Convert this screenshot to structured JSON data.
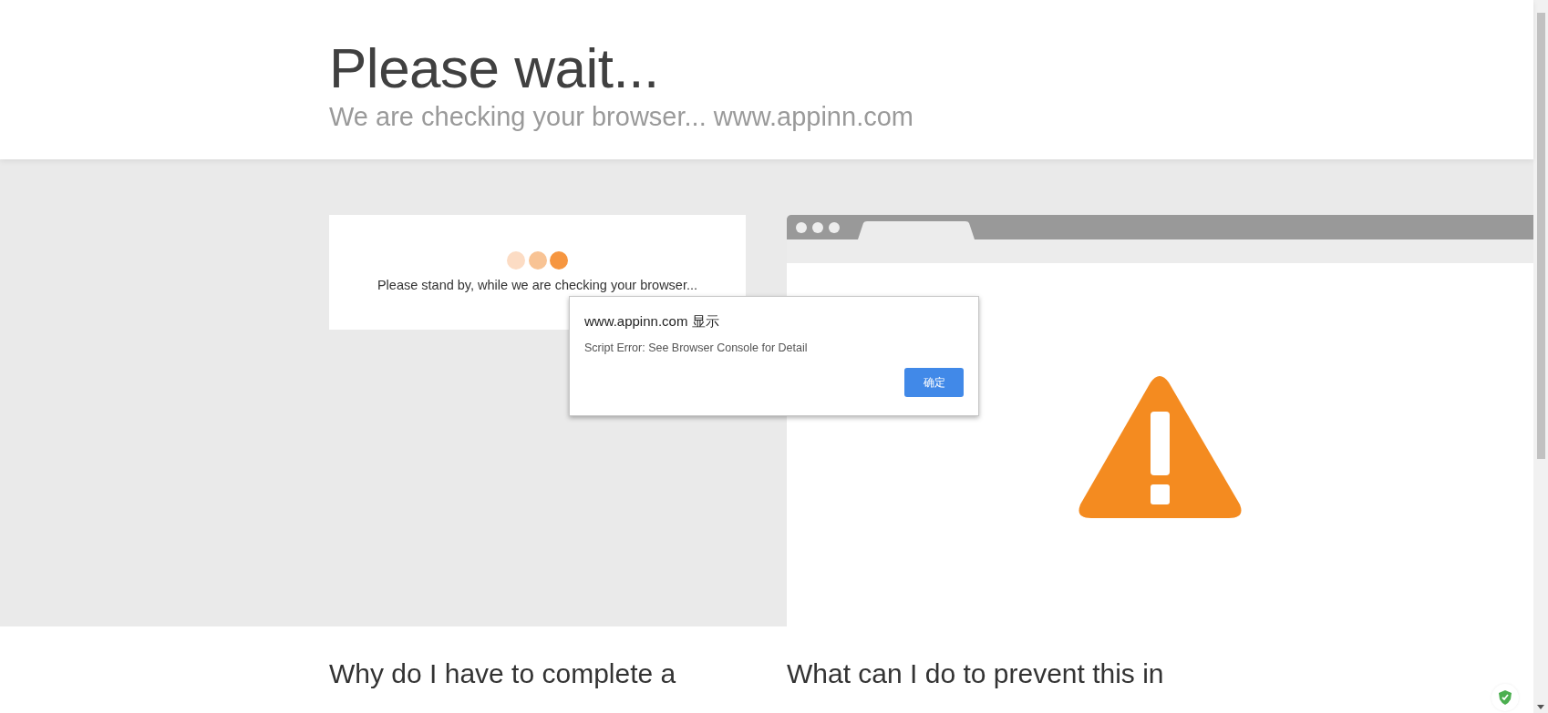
{
  "header": {
    "title": "Please wait...",
    "subtitle": "We are checking your browser... www.appinn.com"
  },
  "status_card": {
    "message": "Please stand by, while we are checking your browser..."
  },
  "dialog": {
    "title": "www.appinn.com 显示",
    "message": "Script Error: See Browser Console for Detail",
    "button": "确定"
  },
  "faq": [
    {
      "heading": "Why do I have to complete a"
    },
    {
      "heading": "What can I do to prevent this in"
    }
  ]
}
